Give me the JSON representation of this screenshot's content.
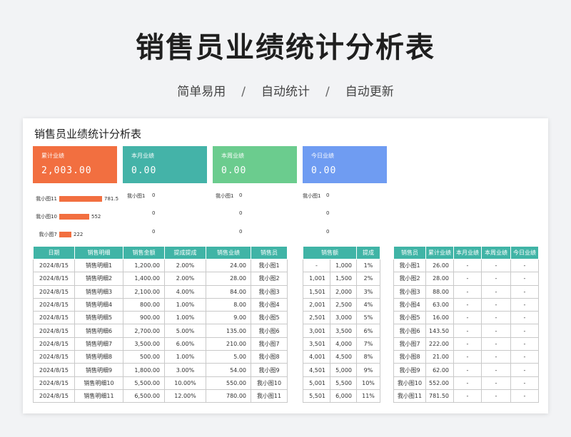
{
  "hero": {
    "title": "销售员业绩统计分析表",
    "tag1": "简单易用",
    "tag2": "自动统计",
    "tag3": "自动更新",
    "sep": "/"
  },
  "sheet": {
    "title": "销售员业绩统计分析表"
  },
  "kpis": [
    {
      "label": "累计业绩",
      "value": "2,003.00",
      "color": "#f26f40"
    },
    {
      "label": "本月业绩",
      "value": "0.00",
      "color": "#44b3a8"
    },
    {
      "label": "本周业绩",
      "value": "0.00",
      "color": "#6bcc8e"
    },
    {
      "label": "今日业绩",
      "value": "0.00",
      "color": "#6f9cf2"
    }
  ],
  "rank_bars": [
    {
      "name": "我小图11",
      "value": "781.5",
      "fraction": 1.0
    },
    {
      "name": "我小图10",
      "value": "552",
      "fraction": 0.706
    },
    {
      "name": "我小图7",
      "value": "222",
      "fraction": 0.284
    }
  ],
  "mini_month": {
    "name": "我小图1",
    "v1": "0",
    "v2": "0",
    "v3": "0"
  },
  "mini_week": {
    "name": "我小图1",
    "v1": "0",
    "v2": "0",
    "v3": "0"
  },
  "mini_day": {
    "name": "我小图1",
    "v1": "0",
    "v2": "0",
    "v3": "0"
  },
  "detail": {
    "headers": [
      "日期",
      "销售明细",
      "销售金额",
      "提成提成",
      "销售业绩",
      "销售员"
    ],
    "rows": [
      [
        "2024/8/15",
        "销售明细1",
        "1,200.00",
        "2.00%",
        "24.00",
        "我小图1"
      ],
      [
        "2024/8/15",
        "销售明细2",
        "1,400.00",
        "2.00%",
        "28.00",
        "我小图2"
      ],
      [
        "2024/8/15",
        "销售明细3",
        "2,100.00",
        "4.00%",
        "84.00",
        "我小图3"
      ],
      [
        "2024/8/15",
        "销售明细4",
        "800.00",
        "1.00%",
        "8.00",
        "我小图4"
      ],
      [
        "2024/8/15",
        "销售明细5",
        "900.00",
        "1.00%",
        "9.00",
        "我小图5"
      ],
      [
        "2024/8/15",
        "销售明细6",
        "2,700.00",
        "5.00%",
        "135.00",
        "我小图6"
      ],
      [
        "2024/8/15",
        "销售明细7",
        "3,500.00",
        "6.00%",
        "210.00",
        "我小图7"
      ],
      [
        "2024/8/15",
        "销售明细8",
        "500.00",
        "1.00%",
        "5.00",
        "我小图8"
      ],
      [
        "2024/8/15",
        "销售明细9",
        "1,800.00",
        "3.00%",
        "54.00",
        "我小图9"
      ],
      [
        "2024/8/15",
        "销售明细10",
        "5,500.00",
        "10.00%",
        "550.00",
        "我小图10"
      ],
      [
        "2024/8/15",
        "销售明细11",
        "6,500.00",
        "12.00%",
        "780.00",
        "我小图11"
      ]
    ]
  },
  "rate": {
    "headers": [
      "销售额",
      "提成"
    ],
    "rows": [
      [
        "-",
        "1,000",
        "1%"
      ],
      [
        "1,001",
        "1,500",
        "2%"
      ],
      [
        "1,501",
        "2,000",
        "3%"
      ],
      [
        "2,001",
        "2,500",
        "4%"
      ],
      [
        "2,501",
        "3,000",
        "5%"
      ],
      [
        "3,001",
        "3,500",
        "6%"
      ],
      [
        "3,501",
        "4,000",
        "7%"
      ],
      [
        "4,001",
        "4,500",
        "8%"
      ],
      [
        "4,501",
        "5,000",
        "9%"
      ],
      [
        "5,001",
        "5,500",
        "10%"
      ],
      [
        "5,501",
        "6,000",
        "11%"
      ]
    ]
  },
  "summary": {
    "headers": [
      "销售员",
      "累计业绩",
      "本月业绩",
      "本周业绩",
      "今日业绩"
    ],
    "rows": [
      [
        "我小图1",
        "26.00",
        "-",
        "-",
        "-"
      ],
      [
        "我小图2",
        "28.00",
        "-",
        "-",
        "-"
      ],
      [
        "我小图3",
        "88.00",
        "-",
        "-",
        "-"
      ],
      [
        "我小图4",
        "63.00",
        "-",
        "-",
        "-"
      ],
      [
        "我小图5",
        "16.00",
        "-",
        "-",
        "-"
      ],
      [
        "我小图6",
        "143.50",
        "-",
        "-",
        "-"
      ],
      [
        "我小图7",
        "222.00",
        "-",
        "-",
        "-"
      ],
      [
        "我小图8",
        "21.00",
        "-",
        "-",
        "-"
      ],
      [
        "我小图9",
        "62.00",
        "-",
        "-",
        "-"
      ],
      [
        "我小图10",
        "552.00",
        "-",
        "-",
        "-"
      ],
      [
        "我小图11",
        "781.50",
        "-",
        "-",
        "-"
      ]
    ]
  }
}
